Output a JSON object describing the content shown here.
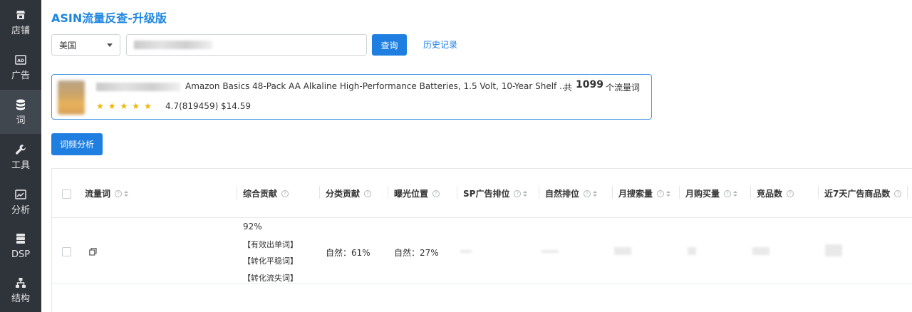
{
  "sidebar": {
    "items": [
      {
        "label": "店铺",
        "icon": "store-icon",
        "active": false
      },
      {
        "label": "广告",
        "icon": "ad-icon",
        "active": false
      },
      {
        "label": "词",
        "icon": "database-icon",
        "active": true
      },
      {
        "label": "工具",
        "icon": "wrench-icon",
        "active": false
      },
      {
        "label": "分析",
        "icon": "chart-icon",
        "active": false
      },
      {
        "label": "DSP",
        "icon": "server-icon",
        "active": false
      },
      {
        "label": "结构",
        "icon": "sitemap-icon",
        "active": false
      }
    ]
  },
  "header": {
    "title": "ASIN流量反查-升级版"
  },
  "search": {
    "country": "美国",
    "query_button": "查询",
    "history_link": "历史记录"
  },
  "product": {
    "title": "Amazon Basics 48-Pack AA Alkaline High-Performance Batteries, 1.5 Volt, 10-Year Shelf ...",
    "count_prefix": "共",
    "count": "1099",
    "count_suffix": "个流量词",
    "stars": 5,
    "rating": "4.7(819459)",
    "price": "$14.59"
  },
  "actions": {
    "analysis_button": "词频分析"
  },
  "table": {
    "columns": [
      {
        "label": "流量词",
        "help": true,
        "sort": true
      },
      {
        "label": "综合贡献",
        "help": true,
        "sort": false
      },
      {
        "label": "分类贡献",
        "help": true,
        "sort": false
      },
      {
        "label": "曝光位置",
        "help": true,
        "sort": false
      },
      {
        "label": "SP广告排位",
        "help": true,
        "sort": true
      },
      {
        "label": "自然排位",
        "help": true,
        "sort": true
      },
      {
        "label": "月搜索量",
        "help": true,
        "sort": true
      },
      {
        "label": "月购买量",
        "help": true,
        "sort": true
      },
      {
        "label": "竞品数",
        "help": true,
        "sort": false
      },
      {
        "label": "近7天广告商品数",
        "help": true,
        "sort": false
      }
    ],
    "rows": [
      {
        "contribution": "92%",
        "tags": [
          "【有效出单词】",
          "【转化平稳词】",
          "【转化流失词】"
        ],
        "category_contribution": "自然：61%",
        "exposure": "自然：27%"
      }
    ]
  },
  "colors": {
    "accent": "#1f7fe0",
    "sidebar": "#2f343b",
    "star": "#f4b400"
  }
}
